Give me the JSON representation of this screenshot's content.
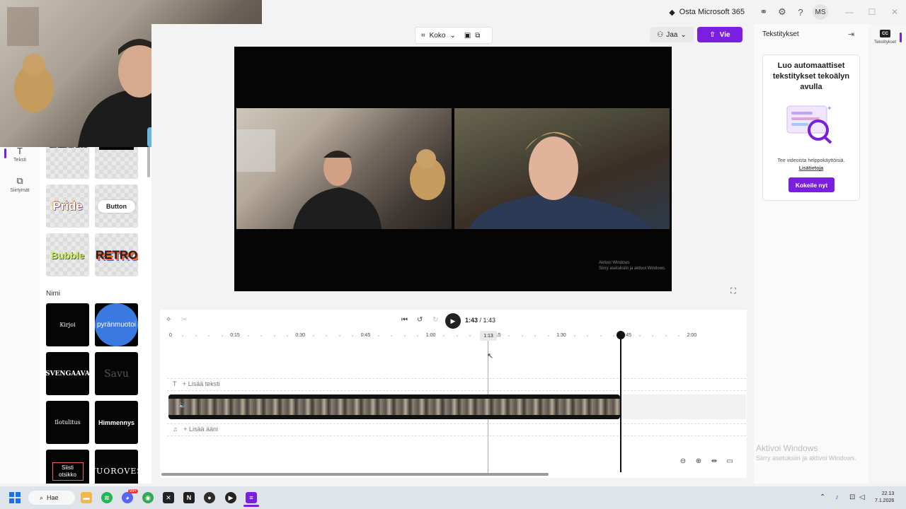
{
  "titlebar": {
    "microsoft_label": "Osta Microsoft 365",
    "avatar_initials": "MS"
  },
  "rail": {
    "items": [
      {
        "label": "Teksti",
        "icon": "text-icon"
      },
      {
        "label": "Siirtymät",
        "icon": "transitions-icon"
      }
    ]
  },
  "panel": {
    "styles_top": [
      "CREATOR",
      "Text box",
      "Pride",
      "Button",
      "Bubble",
      "RETRO"
    ],
    "section_name": "Nimi",
    "titles": [
      "Kirjoi",
      "pyränmuotoi",
      "SVENGAAVA",
      "Savu",
      "Ilotulitus",
      "Himmennys",
      "Siisti otsikko",
      "VUOROVES"
    ]
  },
  "toolbar": {
    "size_label": "Koko",
    "share_label": "Jaa",
    "export_label": "Vie"
  },
  "preview": {
    "watermark_line1": "Aktivoi Windows",
    "watermark_line2": "Siirry asetuksiin ja aktivoi Windows."
  },
  "timeline": {
    "current_time": "1:43",
    "total_time": "1:43",
    "hover_time": "1:13",
    "ruler": [
      "0",
      "0:15",
      "0:30",
      "0:45",
      "1:00",
      "1:15",
      "1:30",
      "1:45",
      "2:00"
    ],
    "add_text": "+ Lisää teksti",
    "add_audio": "+ Lisää ääni"
  },
  "captions_panel": {
    "title": "Tekstitykset",
    "card_title": "Luo automaattiset tekstitykset tekoälyn avulla",
    "card_desc": "Tee videoista helppokäyttöisiä.",
    "learn_more": "Lisätietoja",
    "try_button": "Kokeile nyt",
    "rail_label": "Tekstitykset",
    "cc_badge": "CC"
  },
  "activate": {
    "line1": "Aktivoi Windows",
    "line2": "Siirry asetuksiin ja aktivoi Windows."
  },
  "taskbar": {
    "search_label": "Hae",
    "time": "22.13",
    "date": "7.1.2026",
    "notification_badge": "99+"
  }
}
